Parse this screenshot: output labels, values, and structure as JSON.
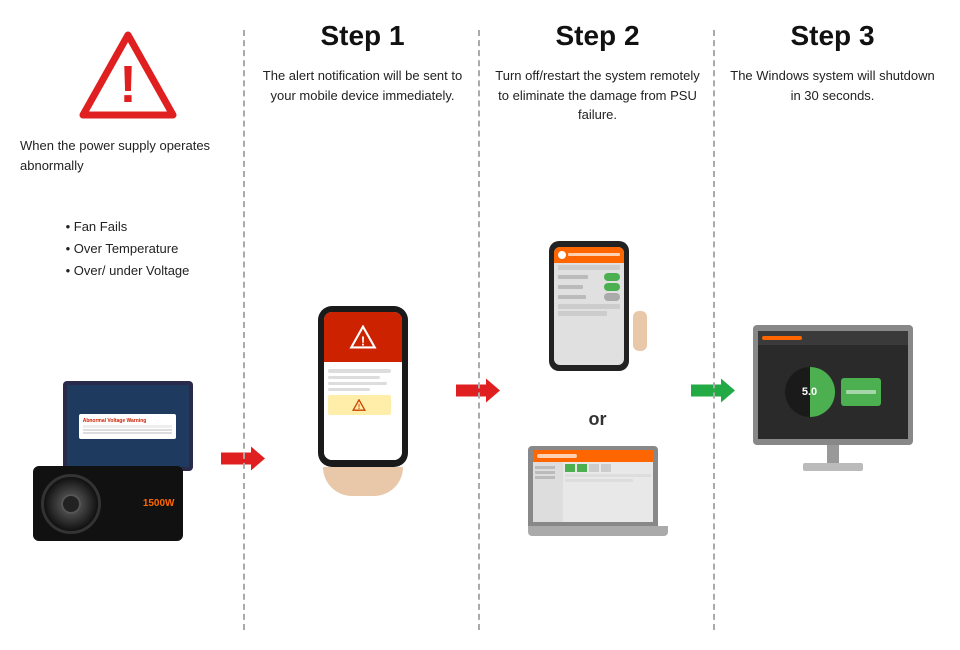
{
  "columns": [
    {
      "id": "intro",
      "step_title": "",
      "description": "When the power supply operates abnormally",
      "bullets": [
        "Fan Fails",
        "Over Temperature",
        "Over/ under Voltage"
      ],
      "arrow_color": "red"
    },
    {
      "id": "step1",
      "step_title": "Step 1",
      "description": "The alert notification will be sent to your mobile device immediately.",
      "bullets": [],
      "arrow_color": "red"
    },
    {
      "id": "step2",
      "step_title": "Step 2",
      "description": "Turn off/restart the system remotely to eliminate the damage from PSU failure.",
      "bullets": [],
      "or_text": "or",
      "arrow_color": "green"
    },
    {
      "id": "step3",
      "step_title": "Step 3",
      "description": "The Windows system will shutdown in 30 seconds.",
      "bullets": []
    }
  ],
  "gauge_value": "5.0"
}
